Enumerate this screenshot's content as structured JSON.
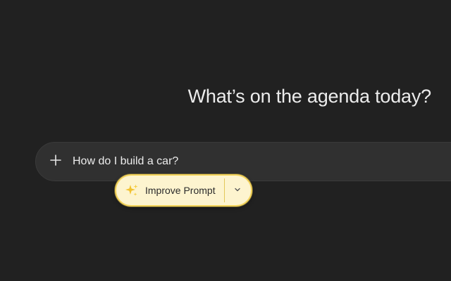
{
  "heading": "What’s on the agenda today?",
  "composer": {
    "add_icon": "plus-icon",
    "input_value": "How do I build a car?"
  },
  "improve_prompt": {
    "icon": "sparkles-icon",
    "label": "Improve Prompt",
    "dropdown_icon": "chevron-down-icon"
  },
  "colors": {
    "background": "#212121",
    "composer": "#303030",
    "pill_fill": "#fdf4cf",
    "pill_border": "#f3d35a",
    "text": "#ececec"
  }
}
